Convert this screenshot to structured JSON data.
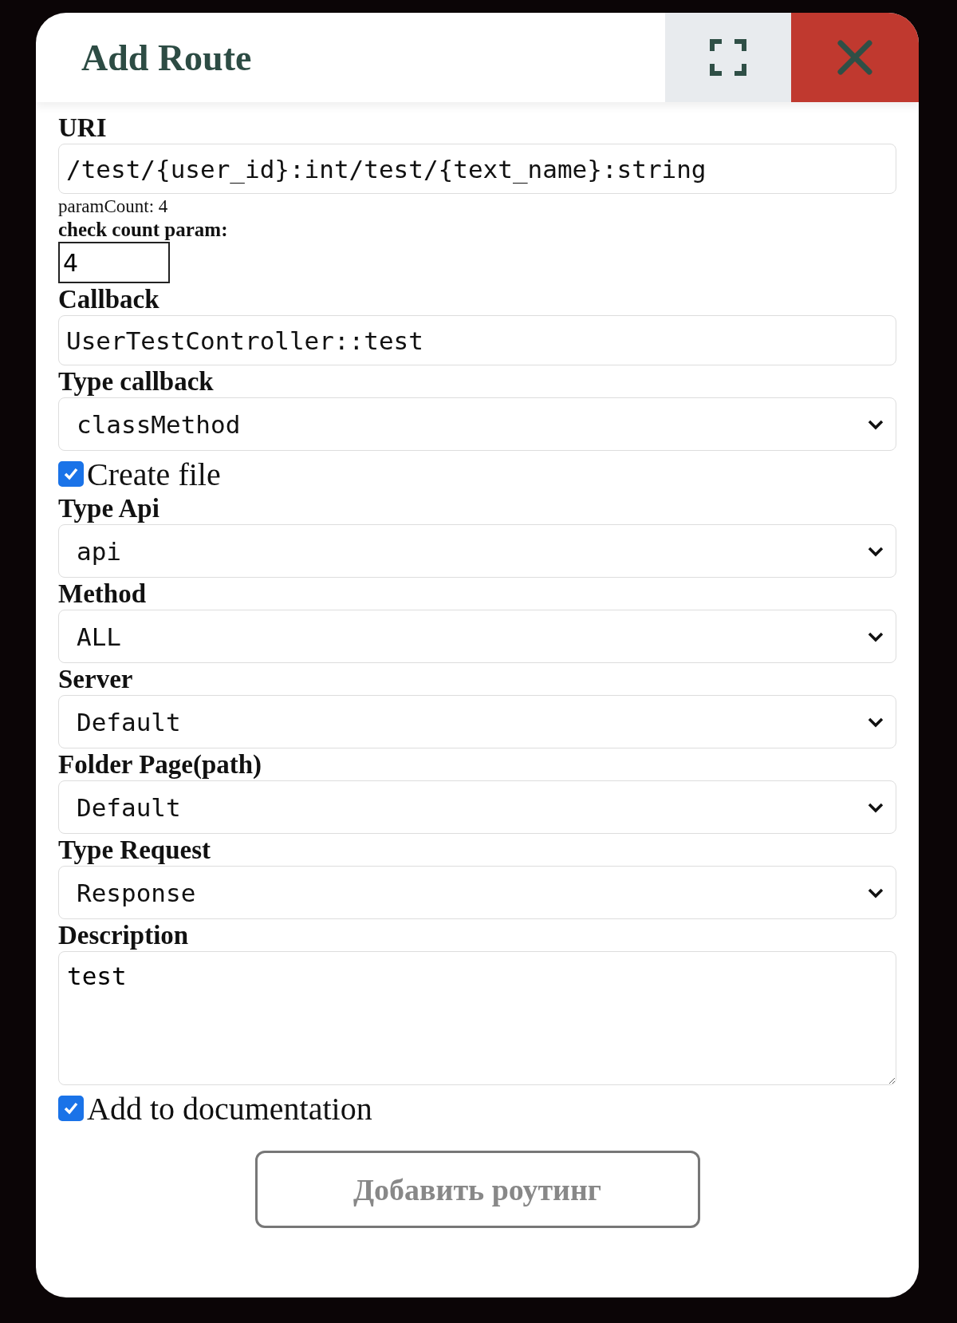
{
  "dialog": {
    "title": "Add Route",
    "actions": [
      {
        "kind": "expand"
      },
      {
        "kind": "close"
      }
    ]
  },
  "fields": [
    {
      "kind": "text",
      "label": "URI",
      "value": "/test/{user_id}:int/test/{text_name}:string"
    },
    {
      "kind": "note",
      "text": "paramCount: 4"
    },
    {
      "kind": "number",
      "label": "check count param:",
      "value": "4"
    },
    {
      "kind": "text",
      "label": "Callback",
      "value": "UserTestController::test"
    },
    {
      "kind": "select",
      "label": "Type callback",
      "value": "classMethod"
    },
    {
      "kind": "checkbox",
      "label": "Create file",
      "checked": true
    },
    {
      "kind": "select",
      "label": "Type Api",
      "value": "api"
    },
    {
      "kind": "select",
      "label": "Method",
      "value": "ALL"
    },
    {
      "kind": "select",
      "label": "Server",
      "value": "Default"
    },
    {
      "kind": "select",
      "label": "Folder Page(path)",
      "value": "Default"
    },
    {
      "kind": "select",
      "label": "Type Request",
      "value": "Response"
    },
    {
      "kind": "textarea",
      "label": "Description",
      "value": "test"
    },
    {
      "kind": "checkbox",
      "label": "Add to documentation",
      "checked": true
    }
  ],
  "submit": {
    "label": "Добавить роутинг",
    "disabled": true
  }
}
